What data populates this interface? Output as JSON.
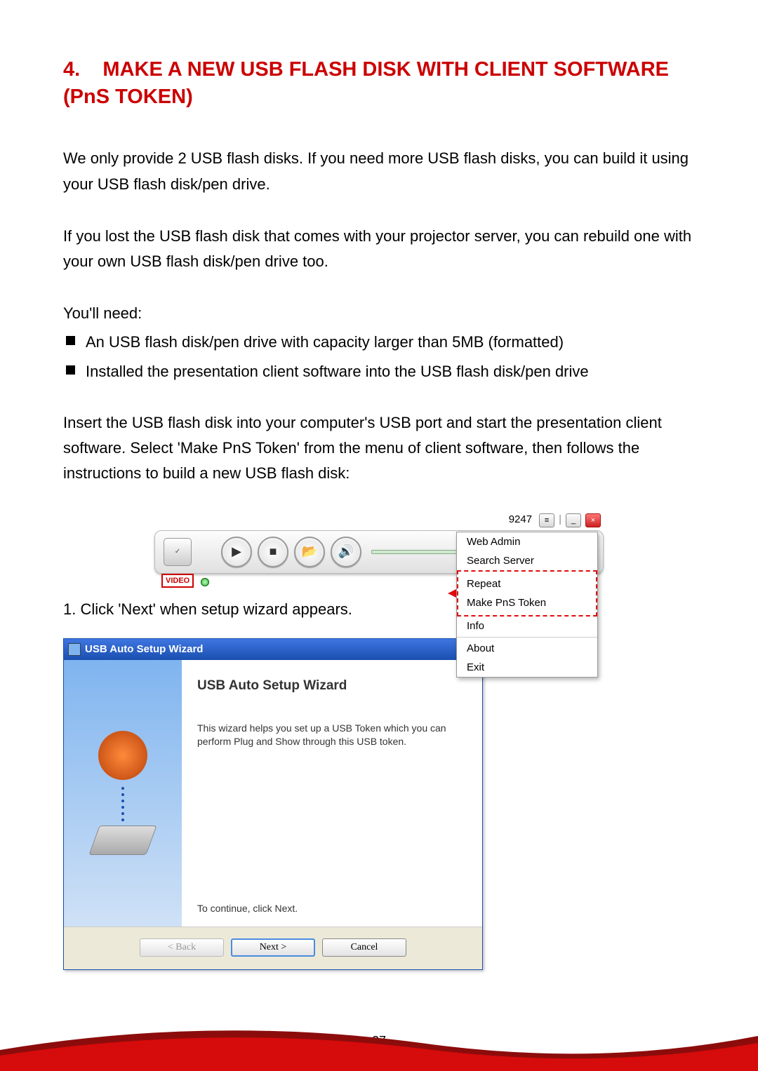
{
  "heading_prefix": "4.",
  "heading_text": "MAKE A NEW USB FLASH DISK WITH CLIENT SOFTWARE (PnS TOKEN)",
  "para1": "We only provide 2 USB flash disks. If you need more USB flash disks, you can build it using your USB flash disk/pen drive.",
  "para2": "If you lost the USB flash disk that comes with your projector server, you can rebuild one with your own USB flash disk/pen drive too.",
  "need_label": "You'll need:",
  "bullets": [
    "An USB flash disk/pen drive with capacity larger than 5MB (formatted)",
    "Installed the presentation client software into the USB flash disk/pen drive"
  ],
  "para3": "Insert the USB flash disk into your computer's USB port and start the presentation client software. Select 'Make PnS Token' from the menu of client software, then follows the instructions to build a new USB flash disk:",
  "step1": "1. Click 'Next' when setup wizard appears.",
  "client": {
    "code": "9247",
    "video_label": "VIDEO",
    "menu": {
      "web_admin": "Web Admin",
      "search_server": "Search Server",
      "repeat": "Repeat",
      "make_token": "Make PnS Token",
      "info": "Info",
      "about": "About",
      "exit": "Exit"
    }
  },
  "wizard": {
    "title": "USB Auto Setup Wizard",
    "heading": "USB Auto Setup Wizard",
    "desc": "This wizard helps you set up a USB Token which you can perform Plug and Show through this USB token.",
    "continue": "To continue, click Next.",
    "back": "< Back",
    "next": "Next >",
    "cancel": "Cancel"
  },
  "page_number": "27"
}
